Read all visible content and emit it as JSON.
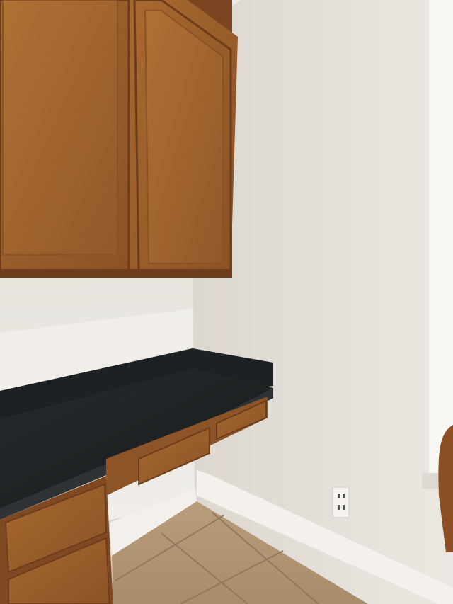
{
  "scene": {
    "description_free": true,
    "colors": {
      "wall_right": "#e4e0d9",
      "wall_left": "#ebe7e1",
      "cabinet_wood": "#9a5e2c",
      "cabinet_wood_dark": "#7a4520",
      "granite": "#1f2426",
      "granite_edge": "#2b3133",
      "baseboard": "#f2efea",
      "tile": "#b39878",
      "grout": "#8f7a60",
      "window_blind": "#f5f5f2",
      "outlet": "#f4f2ee"
    }
  }
}
